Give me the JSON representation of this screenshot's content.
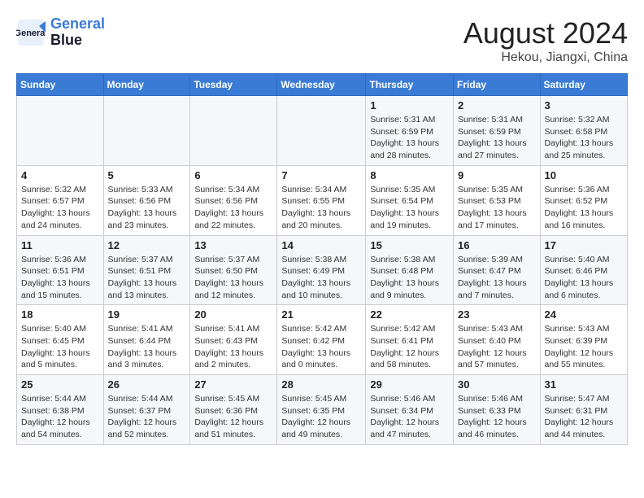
{
  "header": {
    "logo_line1": "General",
    "logo_line2": "Blue",
    "month_title": "August 2024",
    "location": "Hekou, Jiangxi, China"
  },
  "weekdays": [
    "Sunday",
    "Monday",
    "Tuesday",
    "Wednesday",
    "Thursday",
    "Friday",
    "Saturday"
  ],
  "weeks": [
    [
      {
        "day": "",
        "info": ""
      },
      {
        "day": "",
        "info": ""
      },
      {
        "day": "",
        "info": ""
      },
      {
        "day": "",
        "info": ""
      },
      {
        "day": "1",
        "info": "Sunrise: 5:31 AM\nSunset: 6:59 PM\nDaylight: 13 hours and 28 minutes."
      },
      {
        "day": "2",
        "info": "Sunrise: 5:31 AM\nSunset: 6:59 PM\nDaylight: 13 hours and 27 minutes."
      },
      {
        "day": "3",
        "info": "Sunrise: 5:32 AM\nSunset: 6:58 PM\nDaylight: 13 hours and 25 minutes."
      }
    ],
    [
      {
        "day": "4",
        "info": "Sunrise: 5:32 AM\nSunset: 6:57 PM\nDaylight: 13 hours and 24 minutes."
      },
      {
        "day": "5",
        "info": "Sunrise: 5:33 AM\nSunset: 6:56 PM\nDaylight: 13 hours and 23 minutes."
      },
      {
        "day": "6",
        "info": "Sunrise: 5:34 AM\nSunset: 6:56 PM\nDaylight: 13 hours and 22 minutes."
      },
      {
        "day": "7",
        "info": "Sunrise: 5:34 AM\nSunset: 6:55 PM\nDaylight: 13 hours and 20 minutes."
      },
      {
        "day": "8",
        "info": "Sunrise: 5:35 AM\nSunset: 6:54 PM\nDaylight: 13 hours and 19 minutes."
      },
      {
        "day": "9",
        "info": "Sunrise: 5:35 AM\nSunset: 6:53 PM\nDaylight: 13 hours and 17 minutes."
      },
      {
        "day": "10",
        "info": "Sunrise: 5:36 AM\nSunset: 6:52 PM\nDaylight: 13 hours and 16 minutes."
      }
    ],
    [
      {
        "day": "11",
        "info": "Sunrise: 5:36 AM\nSunset: 6:51 PM\nDaylight: 13 hours and 15 minutes."
      },
      {
        "day": "12",
        "info": "Sunrise: 5:37 AM\nSunset: 6:51 PM\nDaylight: 13 hours and 13 minutes."
      },
      {
        "day": "13",
        "info": "Sunrise: 5:37 AM\nSunset: 6:50 PM\nDaylight: 13 hours and 12 minutes."
      },
      {
        "day": "14",
        "info": "Sunrise: 5:38 AM\nSunset: 6:49 PM\nDaylight: 13 hours and 10 minutes."
      },
      {
        "day": "15",
        "info": "Sunrise: 5:38 AM\nSunset: 6:48 PM\nDaylight: 13 hours and 9 minutes."
      },
      {
        "day": "16",
        "info": "Sunrise: 5:39 AM\nSunset: 6:47 PM\nDaylight: 13 hours and 7 minutes."
      },
      {
        "day": "17",
        "info": "Sunrise: 5:40 AM\nSunset: 6:46 PM\nDaylight: 13 hours and 6 minutes."
      }
    ],
    [
      {
        "day": "18",
        "info": "Sunrise: 5:40 AM\nSunset: 6:45 PM\nDaylight: 13 hours and 5 minutes."
      },
      {
        "day": "19",
        "info": "Sunrise: 5:41 AM\nSunset: 6:44 PM\nDaylight: 13 hours and 3 minutes."
      },
      {
        "day": "20",
        "info": "Sunrise: 5:41 AM\nSunset: 6:43 PM\nDaylight: 13 hours and 2 minutes."
      },
      {
        "day": "21",
        "info": "Sunrise: 5:42 AM\nSunset: 6:42 PM\nDaylight: 13 hours and 0 minutes."
      },
      {
        "day": "22",
        "info": "Sunrise: 5:42 AM\nSunset: 6:41 PM\nDaylight: 12 hours and 58 minutes."
      },
      {
        "day": "23",
        "info": "Sunrise: 5:43 AM\nSunset: 6:40 PM\nDaylight: 12 hours and 57 minutes."
      },
      {
        "day": "24",
        "info": "Sunrise: 5:43 AM\nSunset: 6:39 PM\nDaylight: 12 hours and 55 minutes."
      }
    ],
    [
      {
        "day": "25",
        "info": "Sunrise: 5:44 AM\nSunset: 6:38 PM\nDaylight: 12 hours and 54 minutes."
      },
      {
        "day": "26",
        "info": "Sunrise: 5:44 AM\nSunset: 6:37 PM\nDaylight: 12 hours and 52 minutes."
      },
      {
        "day": "27",
        "info": "Sunrise: 5:45 AM\nSunset: 6:36 PM\nDaylight: 12 hours and 51 minutes."
      },
      {
        "day": "28",
        "info": "Sunrise: 5:45 AM\nSunset: 6:35 PM\nDaylight: 12 hours and 49 minutes."
      },
      {
        "day": "29",
        "info": "Sunrise: 5:46 AM\nSunset: 6:34 PM\nDaylight: 12 hours and 47 minutes."
      },
      {
        "day": "30",
        "info": "Sunrise: 5:46 AM\nSunset: 6:33 PM\nDaylight: 12 hours and 46 minutes."
      },
      {
        "day": "31",
        "info": "Sunrise: 5:47 AM\nSunset: 6:31 PM\nDaylight: 12 hours and 44 minutes."
      }
    ]
  ]
}
